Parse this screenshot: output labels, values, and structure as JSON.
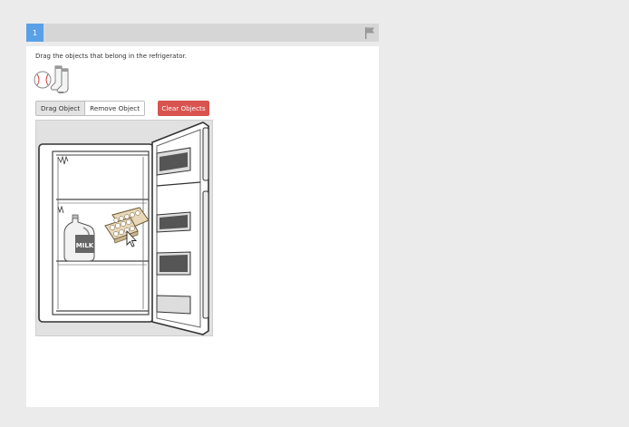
{
  "progress": {
    "current_step": "1"
  },
  "prompt": {
    "text": "Drag the objects that belong in the refrigerator."
  },
  "palette": {
    "items": [
      "baseball-icon",
      "socks-icon"
    ]
  },
  "toolbar": {
    "drag_label": "Drag Object",
    "remove_label": "Remove Object",
    "clear_label": "Clear Objects"
  },
  "stage": {
    "milk_label": "MILK",
    "placed_items": [
      "milk-jug",
      "egg-carton"
    ]
  },
  "colors": {
    "accent": "#5aa0e6",
    "danger": "#d9534f",
    "background": "#ebebeb",
    "panel": "#ffffff"
  }
}
